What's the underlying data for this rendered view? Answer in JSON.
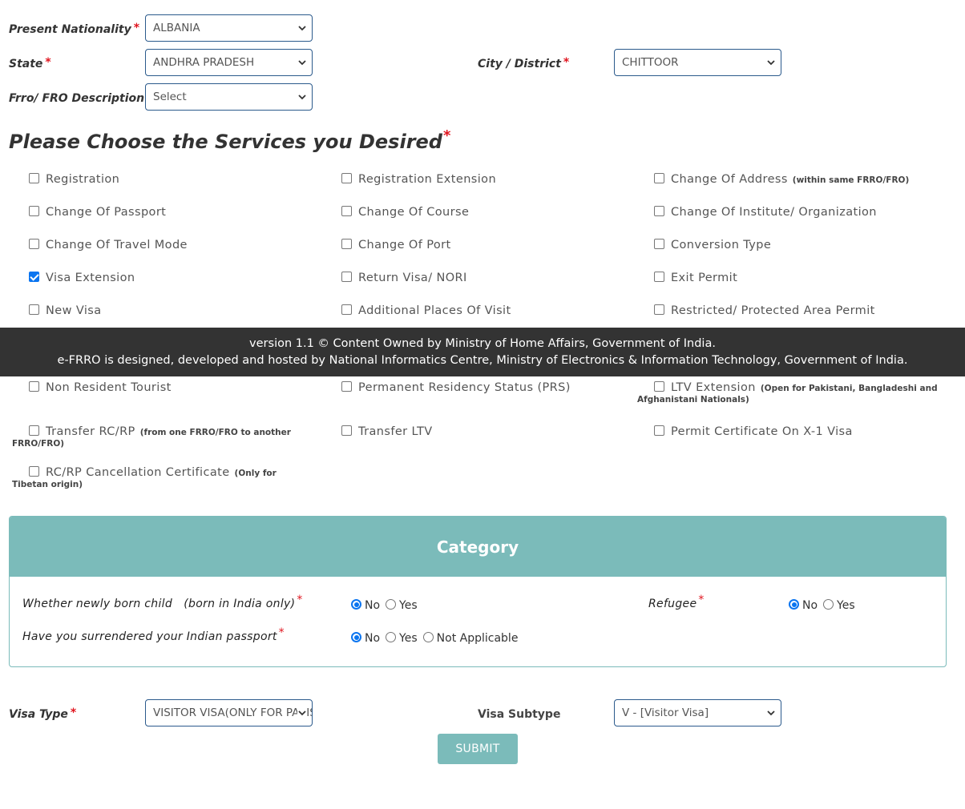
{
  "form": {
    "nationality": {
      "label": "Present Nationality",
      "required": "*",
      "value": "ALBANIA"
    },
    "state": {
      "label": "State",
      "required": "*",
      "value": "ANDHRA PRADESH"
    },
    "city": {
      "label": "City / District",
      "required": "*",
      "value": "CHITTOOR"
    },
    "frro": {
      "label": "Frro/ FRO Description",
      "required": "*",
      "value": "Select"
    }
  },
  "services": {
    "heading": "Please Choose the Services you Desired",
    "required": "*",
    "items": [
      {
        "label": "Registration",
        "checked": false
      },
      {
        "label": "Registration Extension",
        "checked": false
      },
      {
        "label": "Change Of Address",
        "note": "(within same FRRO/FRO)",
        "checked": false
      },
      {
        "label": "Change Of Passport",
        "checked": false
      },
      {
        "label": "Change Of Course",
        "checked": false
      },
      {
        "label": "Change Of Institute/ Organization",
        "checked": false
      },
      {
        "label": "Change Of Travel Mode",
        "checked": false
      },
      {
        "label": "Change Of Port",
        "checked": false
      },
      {
        "label": "Conversion Type",
        "checked": false
      },
      {
        "label": "Visa Extension",
        "checked": true
      },
      {
        "label": "Return Visa/ NORI",
        "checked": false
      },
      {
        "label": "Exit Permit",
        "checked": false
      },
      {
        "label": "New Visa",
        "checked": false
      },
      {
        "label": "Additional Places Of Visit",
        "checked": false
      },
      {
        "label": "Restricted/ Protected Area Permit",
        "checked": false
      },
      {
        "label": "Non Resident Tourist",
        "checked": false
      },
      {
        "label": "Permanent Residency Status (PRS)",
        "checked": false
      },
      {
        "label": "LTV Extension",
        "note": "(Open for Pakistani, Bangladeshi and",
        "note2": "Afghanistani Nationals)",
        "checked": false
      },
      {
        "label": "Transfer RC/RP",
        "note": "(from one FRRO/FRO to another",
        "note2": "FRRO/FRO)",
        "checked": false
      },
      {
        "label": "Transfer LTV",
        "checked": false
      },
      {
        "label": "Permit Certificate On X-1 Visa",
        "checked": false
      },
      {
        "label": "RC/RP Cancellation Certificate",
        "note": "(Only for",
        "note2": "Tibetan origin)",
        "checked": false
      }
    ]
  },
  "footer": {
    "line1": "version 1.1 © Content Owned by Ministry of Home Affairs, Government of India.",
    "line2": "e-FRRO is designed, developed and hosted by National Informatics Centre, Ministry of Electronics & Information Technology, Government of India."
  },
  "category": {
    "title": "Category",
    "newborn": {
      "label": "Whether newly born child   (born in India only)",
      "required": "*",
      "options": [
        "No",
        "Yes"
      ],
      "selected": "No"
    },
    "refugee": {
      "label": "Refugee",
      "required": "*",
      "options": [
        "No",
        "Yes"
      ],
      "selected": "No"
    },
    "passport": {
      "label": "Have you surrendered your Indian passport",
      "required": "*",
      "options": [
        "No",
        "Yes",
        "Not Applicable"
      ],
      "selected": "No"
    }
  },
  "visa": {
    "type": {
      "label": "Visa Type",
      "required": "*",
      "value": "VISITOR VISA(ONLY FOR PAKISTANI NATIONALS)"
    },
    "subtype": {
      "label": "Visa Subtype",
      "value": "V - [Visitor Visa]"
    }
  },
  "submit_label": "SUBMIT",
  "colors": {
    "accent": "#7bbbba",
    "required": "#e0141e",
    "checkbox": "#0b75f0",
    "footer_bg": "#333333"
  }
}
